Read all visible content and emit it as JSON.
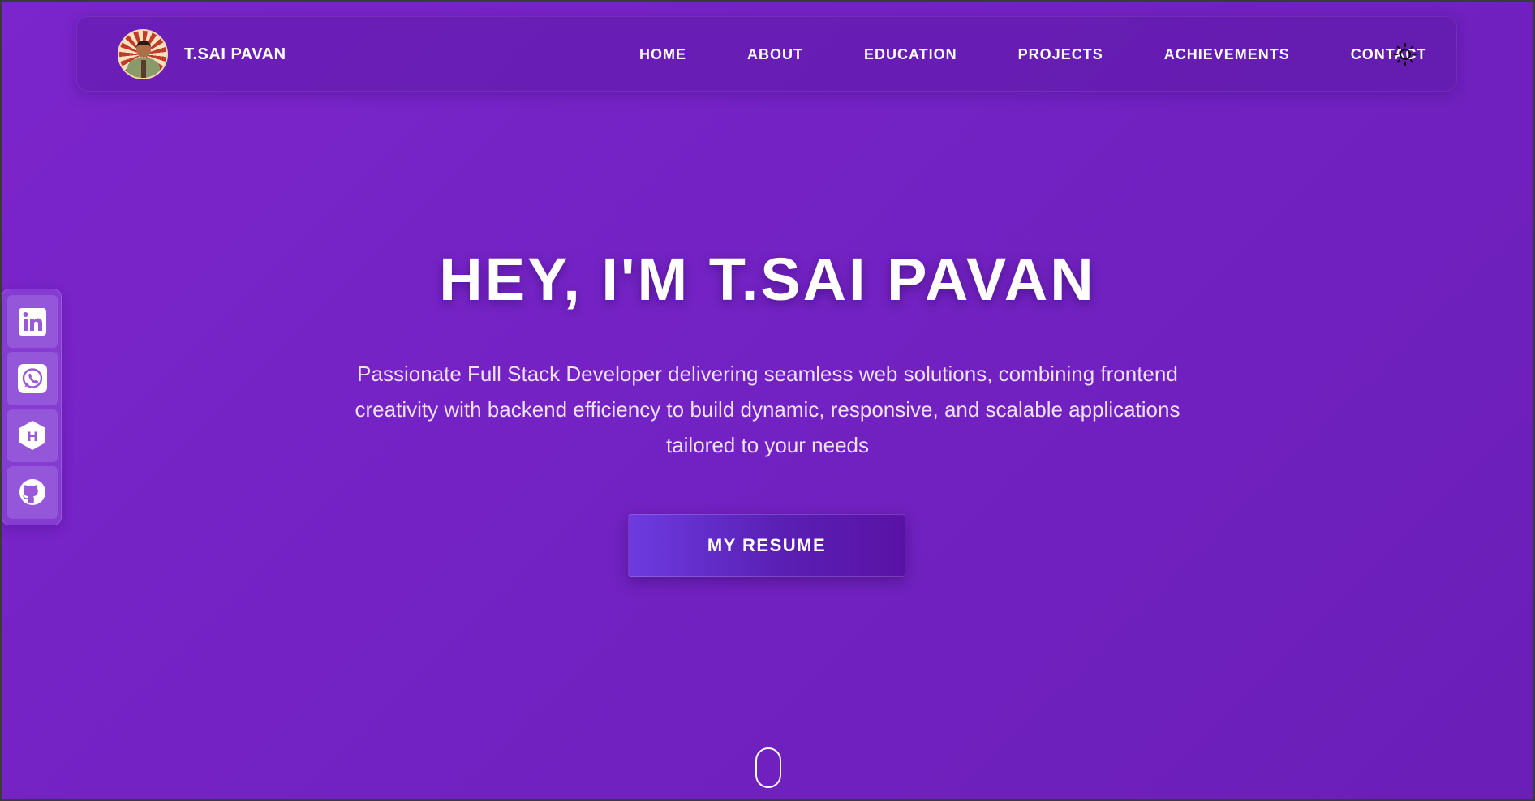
{
  "nav": {
    "brand_name": "T.SAI PAVAN",
    "links": [
      {
        "label": "HOME"
      },
      {
        "label": "ABOUT"
      },
      {
        "label": "EDUCATION"
      },
      {
        "label": "PROJECTS"
      },
      {
        "label": "ACHIEVEMENTS"
      },
      {
        "label": "CONTACT"
      }
    ],
    "theme_icon": "sun-icon"
  },
  "social": {
    "items": [
      {
        "icon": "linkedin-icon"
      },
      {
        "icon": "whatsapp-icon"
      },
      {
        "icon": "hashnode-icon"
      },
      {
        "icon": "github-icon"
      }
    ]
  },
  "hero": {
    "title": "HEY, I'M T.SAI PAVAN",
    "description": "Passionate Full Stack Developer delivering seamless web solutions, combining frontend creativity with backend efficiency to build dynamic, responsive, and scalable applications tailored to your needs",
    "resume_label": "MY RESUME"
  },
  "colors": {
    "background": "#7322c3",
    "text": "#ffffff",
    "button": "#5a1fb4"
  }
}
